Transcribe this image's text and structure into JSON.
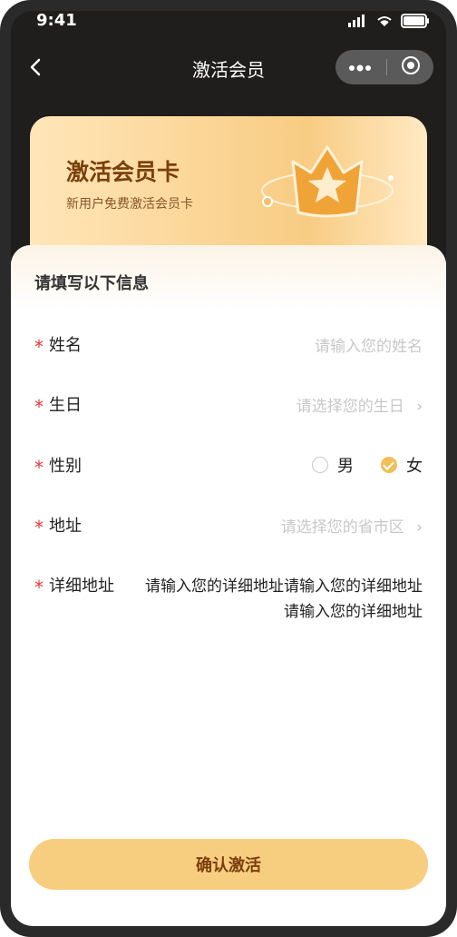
{
  "status_bar": {
    "time": "9:41"
  },
  "nav": {
    "title": "激活会员"
  },
  "card": {
    "title": "激活会员卡",
    "subtitle": "新用户免费激活会员卡"
  },
  "form": {
    "section_title": "请填写以下信息",
    "fields": [
      {
        "label": "姓名",
        "placeholder": "请输入您的姓名"
      },
      {
        "label": "生日",
        "placeholder": "请选择您的生日"
      },
      {
        "label": "性别",
        "options": [
          "男",
          "女"
        ],
        "selected": "女"
      },
      {
        "label": "地址",
        "placeholder": "请选择您的省市区"
      },
      {
        "label": "详细地址",
        "value": "请输入您的详细地址请输入您的详细地址请输入您的详细地址"
      }
    ]
  },
  "submit": {
    "label": "确认激活"
  },
  "colors": {
    "accent": "#f1be58",
    "button": "#f7ce7f",
    "brand_text": "#7a3f0c",
    "required": "#e53935",
    "header_bg": "#1f1e1c"
  },
  "icons": [
    "back-arrow-icon",
    "signal-icon",
    "wifi-icon",
    "battery-icon",
    "more-icon",
    "target-icon",
    "crown-icon",
    "chevron-right-icon",
    "radio-icon",
    "check-icon"
  ]
}
